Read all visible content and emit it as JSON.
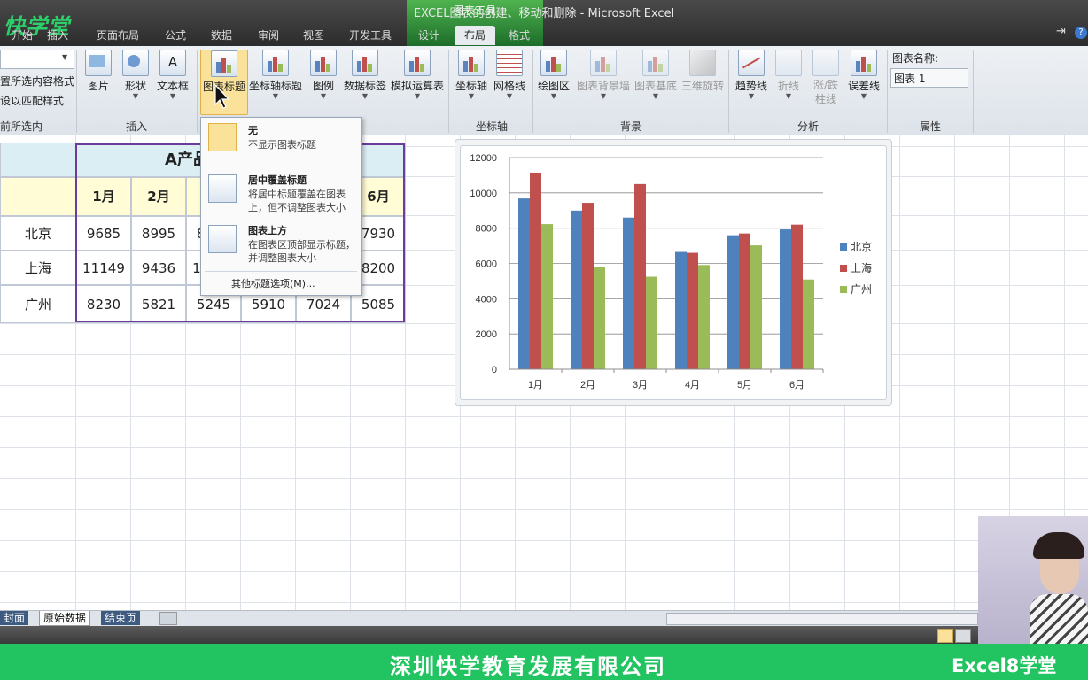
{
  "window": {
    "title": "EXCEL图表的创建、移动和删除 - Microsoft Excel",
    "logo_text": "快学堂"
  },
  "ribbon_tabs": {
    "context_group": "图表工具",
    "tabs": [
      {
        "label": "开始",
        "active": false
      },
      {
        "label": "插入",
        "active": false
      },
      {
        "label": "页面布局",
        "active": false
      },
      {
        "label": "公式",
        "active": false
      },
      {
        "label": "数据",
        "active": false
      },
      {
        "label": "审阅",
        "active": false
      },
      {
        "label": "视图",
        "active": false
      },
      {
        "label": "开发工具",
        "active": false
      },
      {
        "label": "设计",
        "active": false
      },
      {
        "label": "布局",
        "active": true
      },
      {
        "label": "格式",
        "active": false
      }
    ]
  },
  "ribbon": {
    "current_selection": {
      "format_selection": "设置所选内容格式",
      "reset_style": "重设以匹配样式",
      "group": "当前所选内容"
    },
    "insert_group": {
      "label": "插入",
      "picture": "图片",
      "shapes": "形状",
      "textbox": "文本框"
    },
    "labels_group": {
      "label": "标签",
      "chart_title": "图表标题",
      "axis_titles": "坐标轴标题",
      "legend": "图例",
      "data_labels": "数据标签",
      "data_table": "模拟运算表"
    },
    "axes_group": {
      "label": "坐标轴",
      "axes": "坐标轴",
      "gridlines": "网格线"
    },
    "background_group": {
      "label": "背景",
      "plot_area": "绘图区",
      "chart_wall": "图表背景墙",
      "chart_floor": "图表基底",
      "rotation": "三维旋转"
    },
    "analysis_group": {
      "label": "分析",
      "trendline": "趋势线",
      "lines": "折线",
      "updown_bars": "涨/跌柱线",
      "error_bars": "误差线"
    },
    "properties_group": {
      "label": "属性",
      "chart_name_label": "图表名称:",
      "chart_name_value": "图表 1"
    }
  },
  "dropdown_menu": {
    "items": [
      {
        "title": "无",
        "desc": "不显示图表标题"
      },
      {
        "title": "居中覆盖标题",
        "desc": "将居中标题覆盖在图表上，但不调整图表大小"
      },
      {
        "title": "图表上方",
        "desc": "在图表区顶部显示标题，并调整图表大小"
      }
    ],
    "more": "其他标题选项(M)..."
  },
  "table": {
    "title": "A产品销售",
    "months": [
      "1月",
      "2月",
      "3月",
      "4月",
      "5月",
      "6月"
    ],
    "rows": [
      {
        "city": "北京",
        "values": [
          9685,
          8995,
          8600,
          6650,
          7600,
          7930
        ]
      },
      {
        "city": "上海",
        "values": [
          11149,
          9436,
          10500,
          6600,
          7700,
          8200
        ]
      },
      {
        "city": "广州",
        "values": [
          8230,
          5821,
          5245,
          5910,
          7024,
          5085
        ]
      }
    ]
  },
  "chart_data": {
    "type": "bar",
    "categories": [
      "1月",
      "2月",
      "3月",
      "4月",
      "5月",
      "6月"
    ],
    "series": [
      {
        "name": "北京",
        "values": [
          9685,
          8995,
          8600,
          6650,
          7600,
          7930
        ],
        "color": "#4f81bd"
      },
      {
        "name": "上海",
        "values": [
          11149,
          9436,
          10500,
          6600,
          7700,
          8200
        ],
        "color": "#c0504d"
      },
      {
        "name": "广州",
        "values": [
          8230,
          5821,
          5245,
          5910,
          7024,
          5085
        ],
        "color": "#9bbb59"
      }
    ],
    "ylim": [
      0,
      12000
    ],
    "yticks": [
      0,
      2000,
      4000,
      6000,
      8000,
      10000,
      12000
    ],
    "grid": true,
    "legend": "right"
  },
  "sheet_tabs": [
    "封面",
    "原始数据",
    "结束页"
  ],
  "banner": {
    "company": "深圳快学教育发展有限公司",
    "brand": "Excel8学堂"
  }
}
